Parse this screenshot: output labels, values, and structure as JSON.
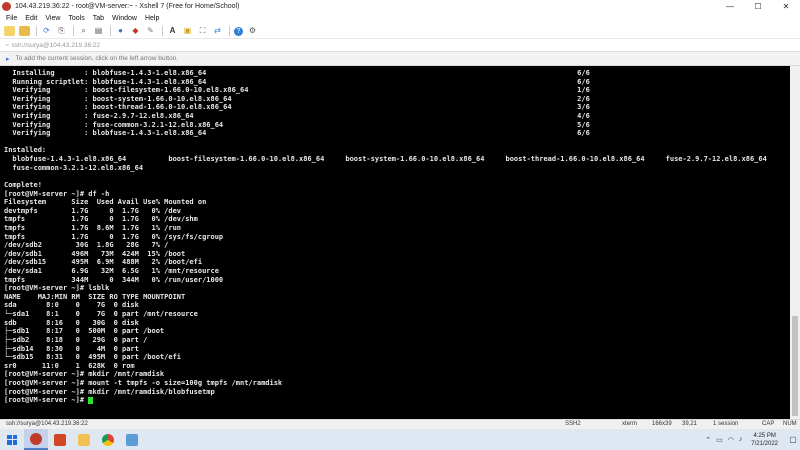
{
  "window": {
    "title": "104.43.219.36:22 - root@VM-server:~ - Xshell 7 (Free for Home/School)",
    "controls": {
      "minimize": "—",
      "maximize": "☐",
      "close": "✕"
    }
  },
  "menu": {
    "items": [
      "File",
      "Edit",
      "View",
      "Tools",
      "Tab",
      "Window",
      "Help"
    ]
  },
  "toolbar": {
    "icons": [
      "new-session-icon",
      "open-folder-icon",
      "reconnect-icon",
      "copy-icon",
      "find-icon",
      "print-icon",
      "globe-icon",
      "color-icon",
      "script-icon",
      "font-icon",
      "lock-icon",
      "fullscreen-icon",
      "help-icon",
      "transfer-icon"
    ]
  },
  "address": {
    "text": "ssh://surya@104.43.219.36:22"
  },
  "hint": {
    "text": "To add the current session, click on the left arrow button."
  },
  "terminal": {
    "lines": [
      "  Installing       : blobfuse-1.4.3-1.el8.x86_64                                                                                        6/6",
      "  Running scriptlet: blobfuse-1.4.3-1.el8.x86_64                                                                                        6/6",
      "  Verifying        : boost-filesystem-1.66.0-10.el8.x86_64                                                                              1/6",
      "  Verifying        : boost-system-1.66.0-10.el8.x86_64                                                                                  2/6",
      "  Verifying        : boost-thread-1.66.0-10.el8.x86_64                                                                                  3/6",
      "  Verifying        : fuse-2.9.7-12.el8.x86_64                                                                                           4/6",
      "  Verifying        : fuse-common-3.2.1-12.el8.x86_64                                                                                    5/6",
      "  Verifying        : blobfuse-1.4.3-1.el8.x86_64                                                                                        6/6",
      "",
      "Installed:",
      "  blobfuse-1.4.3-1.el8.x86_64          boost-filesystem-1.66.0-10.el8.x86_64     boost-system-1.66.0-10.el8.x86_64     boost-thread-1.66.0-10.el8.x86_64     fuse-2.9.7-12.el8.x86_64",
      "  fuse-common-3.2.1-12.el8.x86_64",
      "",
      "Complete!",
      "[root@VM-server ~]# df -h",
      "Filesystem      Size  Used Avail Use% Mounted on",
      "devtmpfs        1.7G     0  1.7G   0% /dev",
      "tmpfs           1.7G     0  1.7G   0% /dev/shm",
      "tmpfs           1.7G  8.6M  1.7G   1% /run",
      "tmpfs           1.7G     0  1.7G   0% /sys/fs/cgroup",
      "/dev/sdb2        30G  1.8G   28G   7% /",
      "/dev/sdb1       496M   73M  424M  15% /boot",
      "/dev/sdb15      495M  6.9M  488M   2% /boot/efi",
      "/dev/sda1       6.9G   32M  6.5G   1% /mnt/resource",
      "tmpfs           344M     0  344M   0% /run/user/1000",
      "[root@VM-server ~]# lsblk",
      "NAME    MAJ:MIN RM  SIZE RO TYPE MOUNTPOINT",
      "sda       8:0    0    7G  0 disk",
      "└─sda1    8:1    0    7G  0 part /mnt/resource",
      "sdb       8:16   0   30G  0 disk",
      "├─sdb1    8:17   0  500M  0 part /boot",
      "├─sdb2    8:18   0   29G  0 part /",
      "├─sdb14   8:30   0    4M  0 part",
      "└─sdb15   8:31   0  495M  0 part /boot/efi",
      "sr0      11:0    1  628K  0 rom",
      "[root@VM-server ~]# mkdir /mnt/ramdisk",
      "[root@VM-server ~]# mount -t tmpfs -o size=100g tmpfs /mnt/ramdisk",
      "[root@VM-server ~]# mkdir /mnt/ramdisk/blobfusetmp",
      "[root@VM-server ~]# "
    ]
  },
  "status": {
    "address": "ssh://surya@104.43.219.36:22",
    "protocol": "SSH2",
    "terminal_type": "xterm",
    "size": "166x39",
    "cursor_pos": "39,21",
    "sessions": "1 session",
    "caps": "CAP",
    "num": "NUM"
  },
  "taskbar": {
    "apps": [
      "xshell-app-icon",
      "powerpoint-app-icon",
      "file-explorer-app-icon",
      "chrome-app-icon",
      "notepad-app-icon"
    ],
    "time": "4:25 PM",
    "date": "7/21/2022"
  },
  "colors": {
    "terminal_bg": "#000000",
    "terminal_fg": "#e8e8e8",
    "cursor": "#29e629",
    "taskbar_bg": "#dfe7f3"
  }
}
